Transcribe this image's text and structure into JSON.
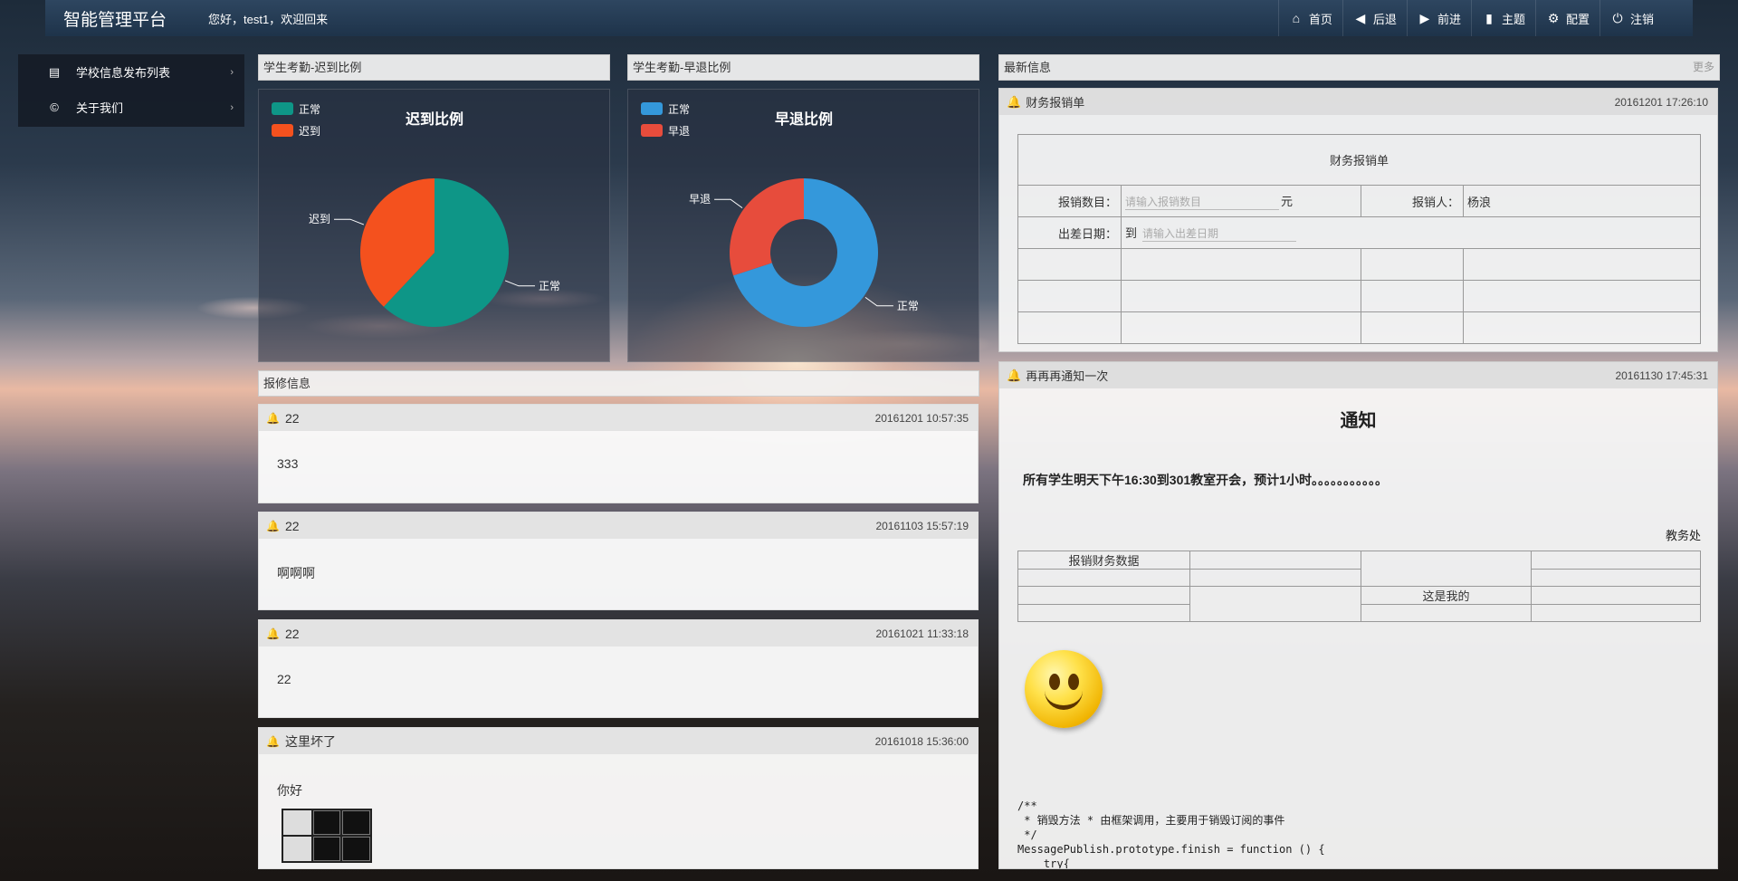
{
  "app": {
    "title": "智能管理平台",
    "welcome": "您好，test1，欢迎回来"
  },
  "nav": [
    {
      "label": "首页",
      "icon": "home-icon",
      "glyph": "⌂"
    },
    {
      "label": "后退",
      "icon": "back-icon",
      "glyph": "◀"
    },
    {
      "label": "前进",
      "icon": "forward-icon",
      "glyph": "▶"
    },
    {
      "label": "主题",
      "icon": "theme-icon",
      "glyph": "▮"
    },
    {
      "label": "配置",
      "icon": "gear-icon",
      "glyph": "⚙"
    },
    {
      "label": "注销",
      "icon": "power-icon",
      "glyph": "⏻"
    }
  ],
  "sidebar": {
    "items": [
      {
        "label": "学校信息发布列表",
        "icon": "list-icon",
        "glyph": "▤"
      },
      {
        "label": "关于我们",
        "icon": "copyright-icon",
        "glyph": "©"
      }
    ]
  },
  "panels": {
    "late": {
      "header": "学生考勤-迟到比例"
    },
    "early": {
      "header": "学生考勤-早退比例"
    },
    "latest": {
      "header": "最新信息",
      "more": "更多"
    },
    "repair": {
      "header": "报修信息"
    }
  },
  "chart_data": [
    {
      "type": "pie",
      "title": "迟到比例",
      "categories": [
        "正常",
        "迟到"
      ],
      "values": [
        62,
        38
      ],
      "colors": [
        "#0e9687",
        "#f4511e"
      ],
      "legend": "top-left"
    },
    {
      "type": "pie",
      "title": "早退比例",
      "categories": [
        "正常",
        "早退"
      ],
      "values": [
        70,
        30
      ],
      "colors": [
        "#3498db",
        "#e74c3c"
      ],
      "legend": "top-left"
    }
  ],
  "repairs": [
    {
      "title": "22",
      "time": "20161201 10:57:35",
      "body": "333",
      "bell_color": "#0e9687"
    },
    {
      "title": "22",
      "time": "20161103 15:57:19",
      "body": "啊啊啊",
      "bell_color": "#0e9687"
    },
    {
      "title": "22",
      "time": "20161021 11:33:18",
      "body": "22",
      "bell_color": "#0e9687"
    },
    {
      "title": "这里坏了",
      "time": "20161018 15:36:00",
      "body": "你好",
      "bell_color": "#e74c3c"
    }
  ],
  "finance": {
    "title": "财务报销单",
    "time": "20161201 17:26:10",
    "form_title": "财务报销单",
    "amount_label": "报销数目：",
    "amount_placeholder": "请输入报销数目",
    "amount_unit": "元",
    "person_label": "报销人：",
    "person_value": "杨浪",
    "date_label": "出差日期：",
    "date_prefix": "到",
    "date_placeholder": "请输入出差日期"
  },
  "notice": {
    "title": "再再再通知一次",
    "time": "20161130 17:45:31",
    "heading": "通知",
    "text": "所有学生明天下午16:30到301教室开会，预计1小时。。。。。。。。。。。",
    "sign": "教务处",
    "table_cell_1": "报销财务数据",
    "table_cell_2": "这是我的",
    "code": "/**\n * 销毁方法 * 由框架调用，主要用于销毁订阅的事件\n */\nMessagePublish.prototype.finish = function () {\n    try{"
  }
}
